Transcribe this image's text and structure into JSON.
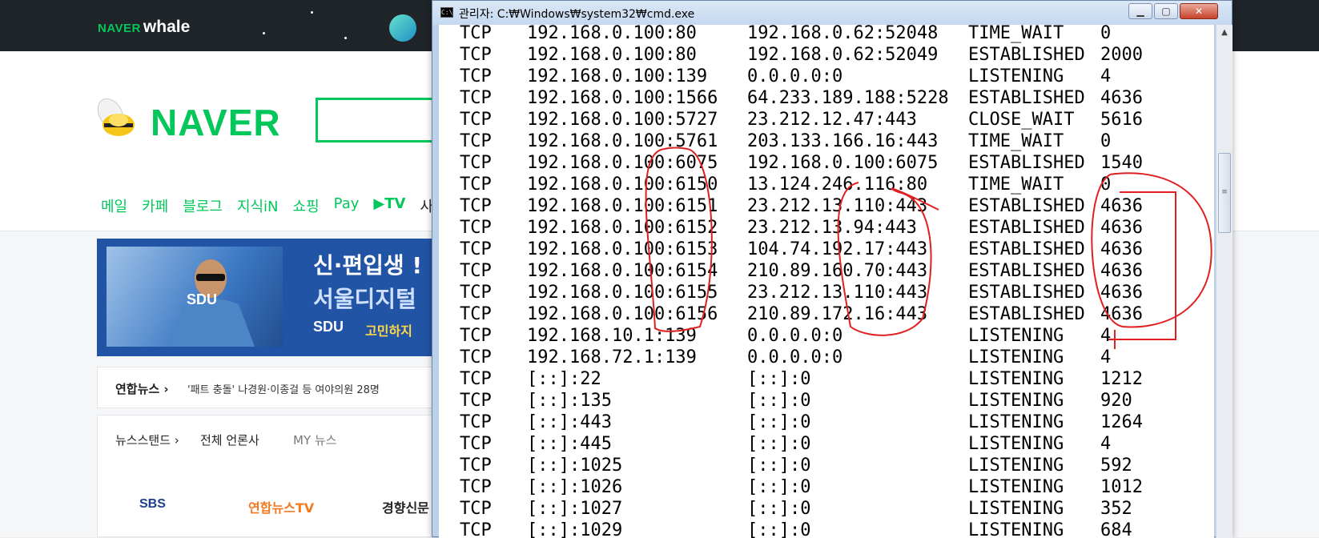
{
  "whale_bar": {
    "brand_naver": "NAVER",
    "brand_whale": "whale"
  },
  "naver": {
    "logo": "NAVER",
    "nav": [
      "메일",
      "카페",
      "블로그",
      "지식iN",
      "쇼핑",
      "Pay",
      "TV",
      "사"
    ],
    "ad": {
      "photo_label": "SDU",
      "headline1": "신·편입생 !",
      "headline2": "서울디지털",
      "brand": "SDU",
      "brand_sub": "고민하지"
    },
    "news": {
      "source": "연합뉴스 ›",
      "headline": "'패트 충돌' 나경원·이종걸 등 여야의원 28명"
    },
    "newsstand": {
      "title": "뉴스스탠드 ›",
      "all": "전체 언론사",
      "my": "MY 뉴스",
      "press": [
        "SBS",
        "연합뉴스TV",
        "경향신문"
      ]
    }
  },
  "cmd": {
    "title": "관리자: C:₩Windows₩system32₩cmd.exe",
    "rows": [
      [
        "TCP",
        "192.168.0.100:80",
        "192.168.0.62:52048",
        "TIME_WAIT",
        "0"
      ],
      [
        "TCP",
        "192.168.0.100:80",
        "192.168.0.62:52049",
        "ESTABLISHED",
        "2000"
      ],
      [
        "TCP",
        "192.168.0.100:139",
        "0.0.0.0:0",
        "LISTENING",
        "4"
      ],
      [
        "TCP",
        "192.168.0.100:1566",
        "64.233.189.188:5228",
        "ESTABLISHED",
        "4636"
      ],
      [
        "TCP",
        "192.168.0.100:5727",
        "23.212.12.47:443",
        "CLOSE_WAIT",
        "5616"
      ],
      [
        "TCP",
        "192.168.0.100:5761",
        "203.133.166.16:443",
        "TIME_WAIT",
        "0"
      ],
      [
        "TCP",
        "192.168.0.100:6075",
        "192.168.0.100:6075",
        "ESTABLISHED",
        "1540"
      ],
      [
        "TCP",
        "192.168.0.100:6150",
        "13.124.246.116:80",
        "TIME_WAIT",
        "0"
      ],
      [
        "TCP",
        "192.168.0.100:6151",
        "23.212.13.110:443",
        "ESTABLISHED",
        "4636"
      ],
      [
        "TCP",
        "192.168.0.100:6152",
        "23.212.13.94:443",
        "ESTABLISHED",
        "4636"
      ],
      [
        "TCP",
        "192.168.0.100:6153",
        "104.74.192.17:443",
        "ESTABLISHED",
        "4636"
      ],
      [
        "TCP",
        "192.168.0.100:6154",
        "210.89.160.70:443",
        "ESTABLISHED",
        "4636"
      ],
      [
        "TCP",
        "192.168.0.100:6155",
        "23.212.13.110:443",
        "ESTABLISHED",
        "4636"
      ],
      [
        "TCP",
        "192.168.0.100:6156",
        "210.89.172.16:443",
        "ESTABLISHED",
        "4636"
      ],
      [
        "TCP",
        "192.168.10.1:139",
        "0.0.0.0:0",
        "LISTENING",
        "4"
      ],
      [
        "TCP",
        "192.168.72.1:139",
        "0.0.0.0:0",
        "LISTENING",
        "4"
      ],
      [
        "TCP",
        "[::]:22",
        "[::]:0",
        "LISTENING",
        "1212"
      ],
      [
        "TCP",
        "[::]:135",
        "[::]:0",
        "LISTENING",
        "920"
      ],
      [
        "TCP",
        "[::]:443",
        "[::]:0",
        "LISTENING",
        "1264"
      ],
      [
        "TCP",
        "[::]:445",
        "[::]:0",
        "LISTENING",
        "4"
      ],
      [
        "TCP",
        "[::]:1025",
        "[::]:0",
        "LISTENING",
        "592"
      ],
      [
        "TCP",
        "[::]:1026",
        "[::]:0",
        "LISTENING",
        "1012"
      ],
      [
        "TCP",
        "[::]:1027",
        "[::]:0",
        "LISTENING",
        "352"
      ],
      [
        "TCP",
        "[::]:1029",
        "[::]:0",
        "LISTENING",
        "684"
      ]
    ]
  },
  "annotation_color": "#e02020"
}
